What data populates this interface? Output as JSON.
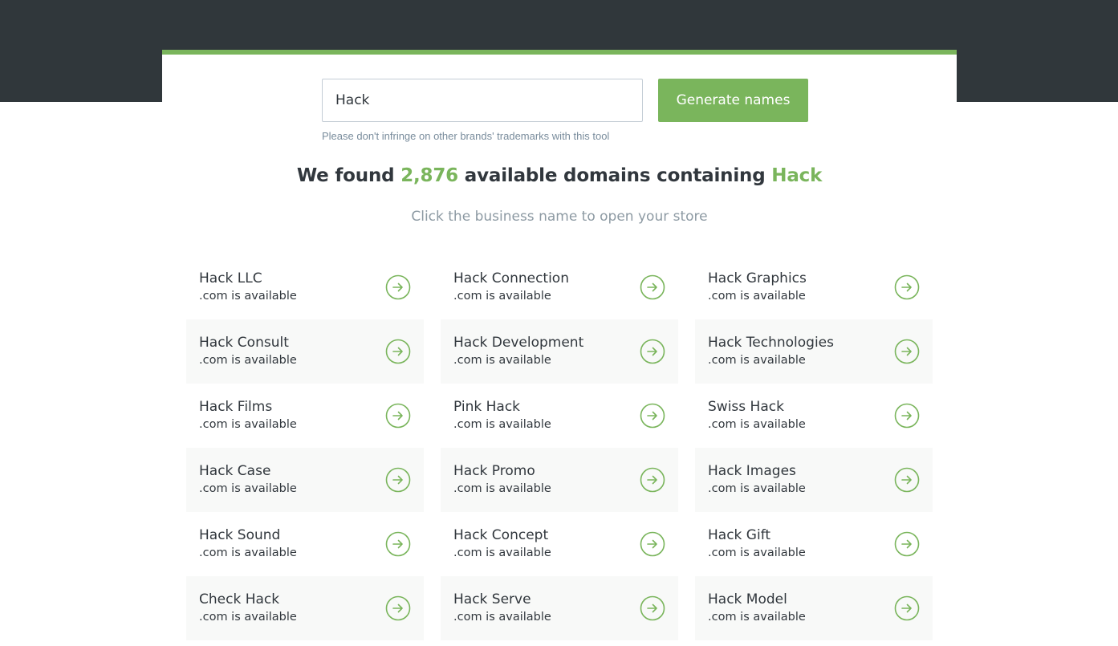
{
  "search": {
    "value": "Hack",
    "button_label": "Generate names",
    "disclaimer": "Please don't infringe on other brands' trademarks with this tool"
  },
  "results": {
    "prefix": "We found ",
    "count": "2,876",
    "middle": " available domains containing ",
    "keyword": "Hack",
    "instruction": "Click the business name to open your store"
  },
  "names": [
    {
      "name": "Hack LLC",
      "status": ".com is available"
    },
    {
      "name": "Hack Connection",
      "status": ".com is available"
    },
    {
      "name": "Hack Graphics",
      "status": ".com is available"
    },
    {
      "name": "Hack Consult",
      "status": ".com is available"
    },
    {
      "name": "Hack Development",
      "status": ".com is available"
    },
    {
      "name": "Hack Technologies",
      "status": ".com is available"
    },
    {
      "name": "Hack Films",
      "status": ".com is available"
    },
    {
      "name": "Pink Hack",
      "status": ".com is available"
    },
    {
      "name": "Swiss Hack",
      "status": ".com is available"
    },
    {
      "name": "Hack Case",
      "status": ".com is available"
    },
    {
      "name": "Hack Promo",
      "status": ".com is available"
    },
    {
      "name": "Hack Images",
      "status": ".com is available"
    },
    {
      "name": "Hack Sound",
      "status": ".com is available"
    },
    {
      "name": "Hack Concept",
      "status": ".com is available"
    },
    {
      "name": "Hack Gift",
      "status": ".com is available"
    },
    {
      "name": "Check Hack",
      "status": ".com is available"
    },
    {
      "name": "Hack Serve",
      "status": ".com is available"
    },
    {
      "name": "Hack Model",
      "status": ".com is available"
    }
  ],
  "icons": {
    "arrow": "arrow-right-circle-icon"
  },
  "colors": {
    "accent": "#7ab55c",
    "header_bg": "#30373b",
    "text": "#31373d",
    "muted": "#8d9aa3"
  }
}
